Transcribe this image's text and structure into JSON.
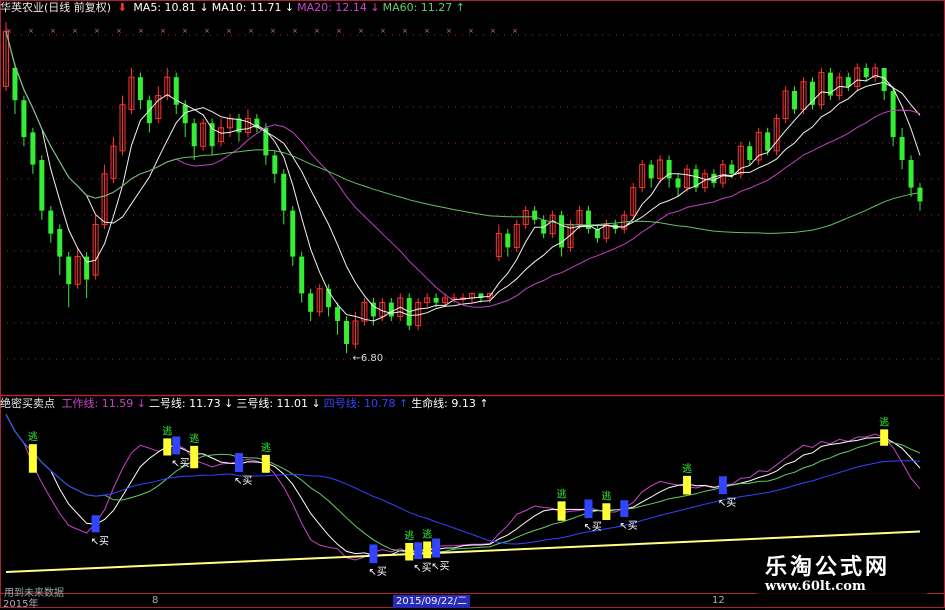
{
  "main_legend": {
    "name": "华英农业(日线 前复权)",
    "items": [
      {
        "label": "MA5: 10.81",
        "arrow": "↓",
        "color": "#ffffff"
      },
      {
        "label": "MA10: 11.71",
        "arrow": "↓",
        "color": "#ffffff"
      },
      {
        "label": "MA20: 12.14",
        "arrow": "↓",
        "color": "#cc44cc"
      },
      {
        "label": "MA60: 11.27",
        "arrow": "↑",
        "color": "#66cc66"
      }
    ]
  },
  "sub_legend": {
    "name": "绝密买卖点",
    "items": [
      {
        "label": "工作线: 11.59",
        "arrow": "↓",
        "color": "#cc44cc"
      },
      {
        "label": "二号线: 11.73",
        "arrow": "↓",
        "color": "#ffffff"
      },
      {
        "label": "三号线: 11.01",
        "arrow": "↓",
        "color": "#ffffff"
      },
      {
        "label": "四号线: 10.78",
        "arrow": "↑",
        "color": "#3344ff"
      },
      {
        "label": "生命线: 9.13",
        "arrow": "↑",
        "color": "#ffffff"
      }
    ]
  },
  "low_label": "6.80",
  "bottom_note": "用到未来数据",
  "date_label": "2015/09/22/二",
  "axis_labels": [
    "2015年",
    "8",
    "12"
  ],
  "watermark": {
    "line1": "乐淘公式网",
    "line2": "www.60lt.com"
  },
  "signals": {
    "escape": "逃",
    "buy": "买"
  },
  "colors": {
    "up": "#ff3333",
    "down": "#33ee33",
    "ma5": "#ffffff",
    "ma10": "#ffffff",
    "ma20": "#cc44cc",
    "ma60": "#66cc66",
    "frame": "#aa2233",
    "yellow_bar": "#ffff33",
    "blue_bar": "#3344ff",
    "life_line": "#ffff88"
  },
  "chart_data": {
    "type": "candlestick",
    "low_marked": 6.8,
    "ylim": [
      6.0,
      14.0
    ],
    "candles": [
      [
        12.6,
        13.8,
        14.0,
        12.5
      ],
      [
        13.0,
        12.3,
        13.1,
        12.0
      ],
      [
        12.3,
        11.5,
        12.4,
        11.3
      ],
      [
        11.6,
        10.9,
        11.7,
        10.7
      ],
      [
        11.0,
        9.9,
        11.1,
        9.7
      ],
      [
        9.9,
        9.4,
        10.0,
        9.2
      ],
      [
        9.5,
        8.9,
        9.6,
        8.5
      ],
      [
        8.9,
        8.3,
        9.0,
        7.8
      ],
      [
        8.3,
        8.9,
        9.1,
        8.2
      ],
      [
        8.9,
        8.4,
        9.0,
        8.0
      ],
      [
        8.5,
        9.6,
        9.8,
        8.4
      ],
      [
        9.6,
        10.7,
        10.9,
        9.5
      ],
      [
        10.6,
        11.3,
        11.5,
        10.5
      ],
      [
        11.2,
        12.2,
        12.4,
        11.1
      ],
      [
        12.1,
        12.8,
        13.0,
        12.0
      ],
      [
        12.8,
        12.3,
        12.9,
        12.1
      ],
      [
        12.3,
        11.8,
        12.4,
        11.6
      ],
      [
        11.9,
        12.4,
        12.6,
        11.8
      ],
      [
        12.4,
        12.8,
        13.0,
        12.3
      ],
      [
        12.8,
        12.2,
        12.9,
        12.0
      ],
      [
        12.2,
        11.8,
        12.3,
        11.5
      ],
      [
        11.8,
        11.3,
        11.9,
        11.0
      ],
      [
        11.3,
        11.8,
        11.9,
        11.2
      ],
      [
        11.8,
        11.3,
        11.9,
        11.1
      ],
      [
        11.4,
        11.7,
        11.9,
        11.3
      ],
      [
        11.7,
        11.9,
        12.0,
        11.5
      ],
      [
        11.9,
        11.6,
        12.0,
        11.4
      ],
      [
        11.6,
        11.9,
        12.1,
        11.5
      ],
      [
        11.9,
        11.7,
        12.0,
        11.6
      ],
      [
        11.7,
        11.1,
        11.8,
        10.9
      ],
      [
        11.1,
        10.7,
        11.2,
        10.5
      ],
      [
        10.7,
        9.9,
        10.8,
        9.6
      ],
      [
        9.9,
        8.9,
        10.0,
        8.7
      ],
      [
        8.9,
        8.1,
        9.0,
        7.9
      ],
      [
        8.1,
        7.7,
        8.2,
        7.5
      ],
      [
        7.7,
        8.2,
        8.3,
        7.6
      ],
      [
        8.2,
        7.8,
        8.3,
        7.6
      ],
      [
        7.8,
        7.5,
        7.9,
        7.2
      ],
      [
        7.5,
        7.0,
        7.6,
        6.8
      ],
      [
        7.0,
        7.5,
        7.7,
        6.9
      ],
      [
        7.5,
        7.9,
        8.0,
        7.4
      ],
      [
        7.9,
        7.6,
        8.0,
        7.4
      ],
      [
        7.6,
        7.9,
        8.0,
        7.5
      ],
      [
        7.9,
        7.6,
        8.0,
        7.5
      ],
      [
        7.6,
        8.0,
        8.1,
        7.5
      ],
      [
        8.0,
        7.4,
        8.1,
        7.3
      ],
      [
        7.4,
        7.9,
        8.0,
        7.3
      ],
      [
        7.9,
        8.0,
        8.1,
        7.8
      ],
      [
        8.0,
        7.9,
        8.1,
        7.8
      ],
      [
        7.9,
        8.0,
        8.1,
        7.8
      ],
      [
        8.0,
        8.0,
        8.1,
        7.9
      ],
      [
        8.0,
        8.0,
        8.1,
        7.9
      ],
      [
        8.0,
        8.1,
        8.1,
        7.9
      ],
      [
        8.1,
        8.0,
        8.1,
        7.9
      ],
      [
        8.0,
        8.1,
        8.1,
        7.9
      ],
      [
        8.9,
        9.4,
        9.6,
        8.8
      ],
      [
        9.4,
        9.1,
        9.5,
        8.9
      ],
      [
        9.1,
        9.6,
        9.7,
        9.0
      ],
      [
        9.6,
        9.9,
        10.0,
        9.5
      ],
      [
        9.9,
        9.7,
        10.0,
        9.6
      ],
      [
        9.7,
        9.4,
        9.8,
        9.3
      ],
      [
        9.4,
        9.8,
        9.9,
        9.3
      ],
      [
        9.8,
        9.1,
        9.9,
        8.9
      ],
      [
        9.1,
        9.6,
        9.7,
        9.0
      ],
      [
        9.6,
        9.9,
        10.0,
        9.5
      ],
      [
        9.9,
        9.5,
        10.0,
        9.4
      ],
      [
        9.5,
        9.3,
        9.6,
        9.2
      ],
      [
        9.3,
        9.6,
        9.7,
        9.2
      ],
      [
        9.6,
        9.5,
        9.7,
        9.4
      ],
      [
        9.5,
        9.8,
        9.9,
        9.4
      ],
      [
        9.8,
        10.4,
        10.5,
        9.7
      ],
      [
        10.4,
        10.9,
        11.0,
        10.3
      ],
      [
        10.9,
        10.6,
        11.0,
        10.4
      ],
      [
        10.6,
        11.0,
        11.1,
        10.5
      ],
      [
        11.0,
        10.6,
        11.1,
        10.4
      ],
      [
        10.6,
        10.4,
        10.7,
        10.2
      ],
      [
        10.4,
        10.8,
        10.9,
        10.3
      ],
      [
        10.8,
        10.4,
        10.9,
        10.3
      ],
      [
        10.4,
        10.7,
        10.8,
        10.3
      ],
      [
        10.7,
        10.5,
        10.8,
        10.4
      ],
      [
        10.5,
        10.9,
        11.0,
        10.4
      ],
      [
        10.9,
        10.7,
        11.0,
        10.6
      ],
      [
        10.7,
        11.3,
        11.4,
        10.6
      ],
      [
        11.3,
        11.0,
        11.4,
        10.9
      ],
      [
        11.0,
        11.6,
        11.7,
        10.9
      ],
      [
        11.6,
        11.2,
        11.7,
        11.1
      ],
      [
        11.2,
        11.9,
        12.0,
        11.1
      ],
      [
        11.9,
        12.5,
        12.6,
        11.8
      ],
      [
        12.5,
        12.1,
        12.6,
        12.0
      ],
      [
        12.1,
        12.7,
        12.8,
        12.0
      ],
      [
        12.7,
        12.2,
        12.8,
        12.1
      ],
      [
        12.2,
        12.9,
        13.0,
        12.1
      ],
      [
        12.9,
        12.4,
        13.0,
        12.3
      ],
      [
        12.4,
        12.8,
        12.9,
        12.3
      ],
      [
        12.8,
        12.6,
        12.9,
        12.5
      ],
      [
        12.6,
        13.0,
        13.1,
        12.5
      ],
      [
        13.0,
        12.8,
        13.1,
        12.7
      ],
      [
        12.8,
        13.0,
        13.1,
        12.7
      ],
      [
        13.0,
        12.5,
        13.0,
        12.3
      ],
      [
        12.5,
        11.5,
        12.6,
        11.3
      ],
      [
        11.5,
        11.0,
        11.7,
        10.8
      ],
      [
        11.0,
        10.4,
        11.1,
        10.2
      ],
      [
        10.4,
        10.1,
        10.5,
        9.9
      ]
    ]
  }
}
